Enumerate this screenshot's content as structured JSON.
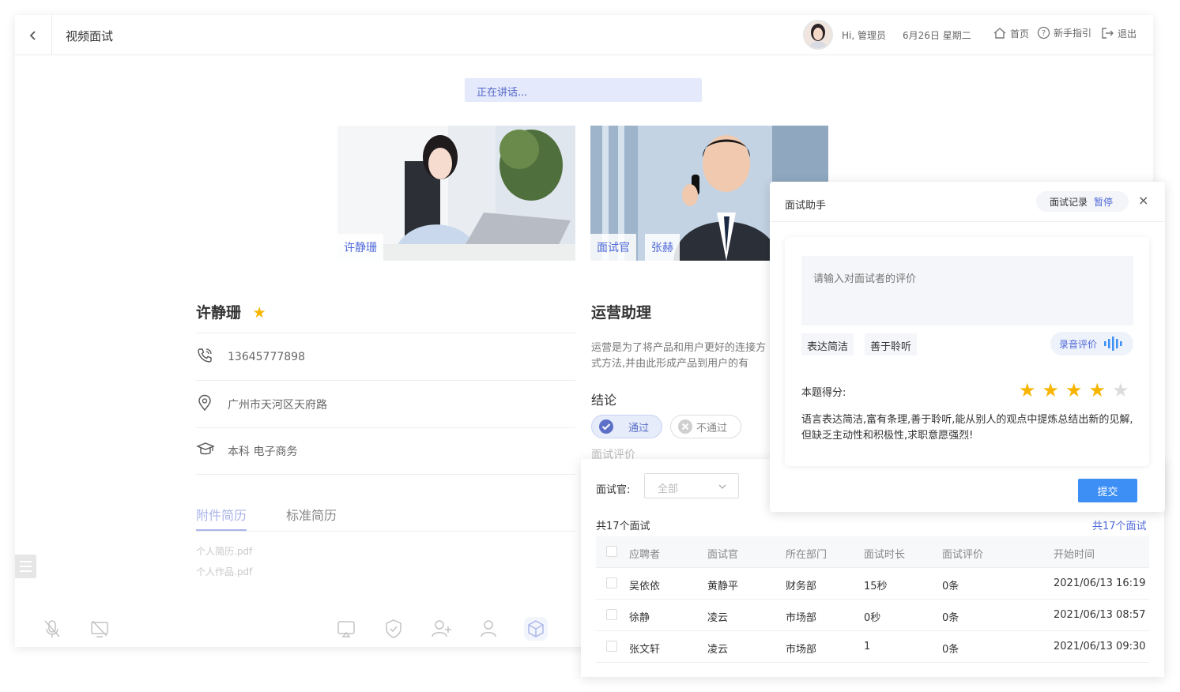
{
  "header": {
    "title": "视频面试",
    "greeting": "Hi, 管理员",
    "date": "6月26日 星期二",
    "nav_home": "首页",
    "nav_guide": "新手指引",
    "nav_logout": "退出"
  },
  "speaking_status": "正在讲话...",
  "videos": {
    "candidate_tag": "许静珊",
    "interviewer_role": "面试官",
    "interviewer_name": "张赫"
  },
  "candidate": {
    "name": "许静珊",
    "phone": "13645777898",
    "address": "广州市天河区天府路",
    "education": "本科 电子商务",
    "tabs": [
      "附件简历",
      "标准简历"
    ],
    "files": [
      "个人简历.pdf",
      "个人作品.pdf"
    ]
  },
  "job": {
    "title": "运营助理",
    "description": "运营是为了将产品和用户更好的连接方式方法,并由此形成产品到用户的有",
    "conclusion_label": "结论",
    "pass_label": "通过",
    "fail_label": "不通过",
    "eval_label": "面试评价"
  },
  "history": {
    "filter_label": "面试官:",
    "filter_value": "全部",
    "count_text": "共17个面试",
    "count_link": "共17个面试",
    "columns": [
      "应聘者",
      "面试官",
      "所在部门",
      "面试时长",
      "面试评价",
      "开始时间"
    ],
    "rows": [
      [
        "吴依依",
        "黄静平",
        "财务部",
        "15秒",
        "0条",
        "2021/06/13  16:19"
      ],
      [
        "徐静",
        "凌云",
        "市场部",
        "0秒",
        "0条",
        "2021/06/13  08:57"
      ],
      [
        "张文轩",
        "凌云",
        "市场部",
        "1",
        "0条",
        "2021/06/13  09:30"
      ]
    ]
  },
  "assistant": {
    "title": "面试助手",
    "record_label": "面试记录",
    "pause_label": "暂停",
    "close_symbol": "×",
    "input_placeholder": "请输入对面试者的评价",
    "tags": [
      "表达简洁",
      "善于聆听"
    ],
    "voice_label": "录音评价",
    "score_label": "本题得分:",
    "score": 4,
    "score_max": 5,
    "comment": "语言表达简洁,富有条理,善于聆听,能从别人的观点中提炼总结出新的见解,但缺乏主动性和积极性,求职意愿强烈!",
    "submit_label": "提交"
  },
  "colors": {
    "accent": "#4f68d8",
    "submit": "#3d8ff6",
    "star": "#f7b500"
  }
}
